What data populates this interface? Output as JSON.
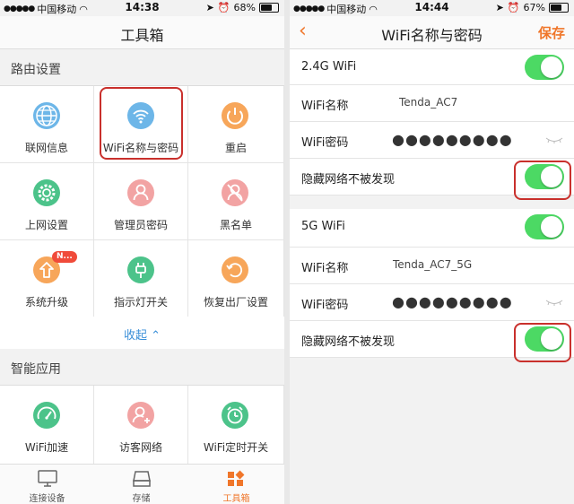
{
  "left": {
    "status": {
      "carrier": "中国移动",
      "time": "14:38",
      "battery": "68%"
    },
    "title": "工具箱",
    "router_section": "路由设置",
    "router_items": [
      {
        "label": "联网信息",
        "icon": "globe-icon"
      },
      {
        "label": "WiFi名称与密码",
        "icon": "wifi-icon"
      },
      {
        "label": "重启",
        "icon": "power-icon"
      },
      {
        "label": "上网设置",
        "icon": "gear-icon"
      },
      {
        "label": "管理员密码",
        "icon": "admin-user-icon"
      },
      {
        "label": "黑名单",
        "icon": "blocked-user-icon"
      },
      {
        "label": "系统升级",
        "icon": "upgrade-arrow-icon",
        "badge": "N..."
      },
      {
        "label": "指示灯开关",
        "icon": "led-plug-icon"
      },
      {
        "label": "恢复出厂设置",
        "icon": "restore-icon"
      }
    ],
    "collapse_label": "收起 ⌃",
    "smart_section": "智能应用",
    "smart_items": [
      {
        "label": "WiFi加速",
        "icon": "speedometer-icon"
      },
      {
        "label": "访客网络",
        "icon": "guest-user-icon"
      },
      {
        "label": "WiFi定时开关",
        "icon": "alarm-clock-icon"
      }
    ],
    "tabs": [
      {
        "label": "连接设备",
        "icon": "monitor-icon"
      },
      {
        "label": "存储",
        "icon": "storage-icon"
      },
      {
        "label": "工具箱",
        "icon": "toolbox-icon",
        "active": true
      }
    ]
  },
  "right": {
    "status": {
      "carrier": "中国移动",
      "time": "14:44",
      "battery": "67%"
    },
    "title": "WiFi名称与密码",
    "save_label": "保存",
    "band24": {
      "label": "2.4G WiFi",
      "name_key": "WiFi名称",
      "name_value": "Tenda_AC7",
      "pw_key": "WiFi密码",
      "pw_value": "●●●●●●●●●",
      "hide_label": "隐藏网络不被发现"
    },
    "band5": {
      "label": "5G WiFi",
      "name_key": "WiFi名称",
      "name_value": "Tenda_AC7_5G",
      "pw_key": "WiFi密码",
      "pw_value": "●●●●●●●●●",
      "hide_label": "隐藏网络不被发现"
    }
  },
  "colors": {
    "accent": "#f0762a",
    "toggle_on": "#4cd964",
    "highlight": "#c9302c",
    "link": "#3a8fd8",
    "icon_green": "#34b36b"
  }
}
